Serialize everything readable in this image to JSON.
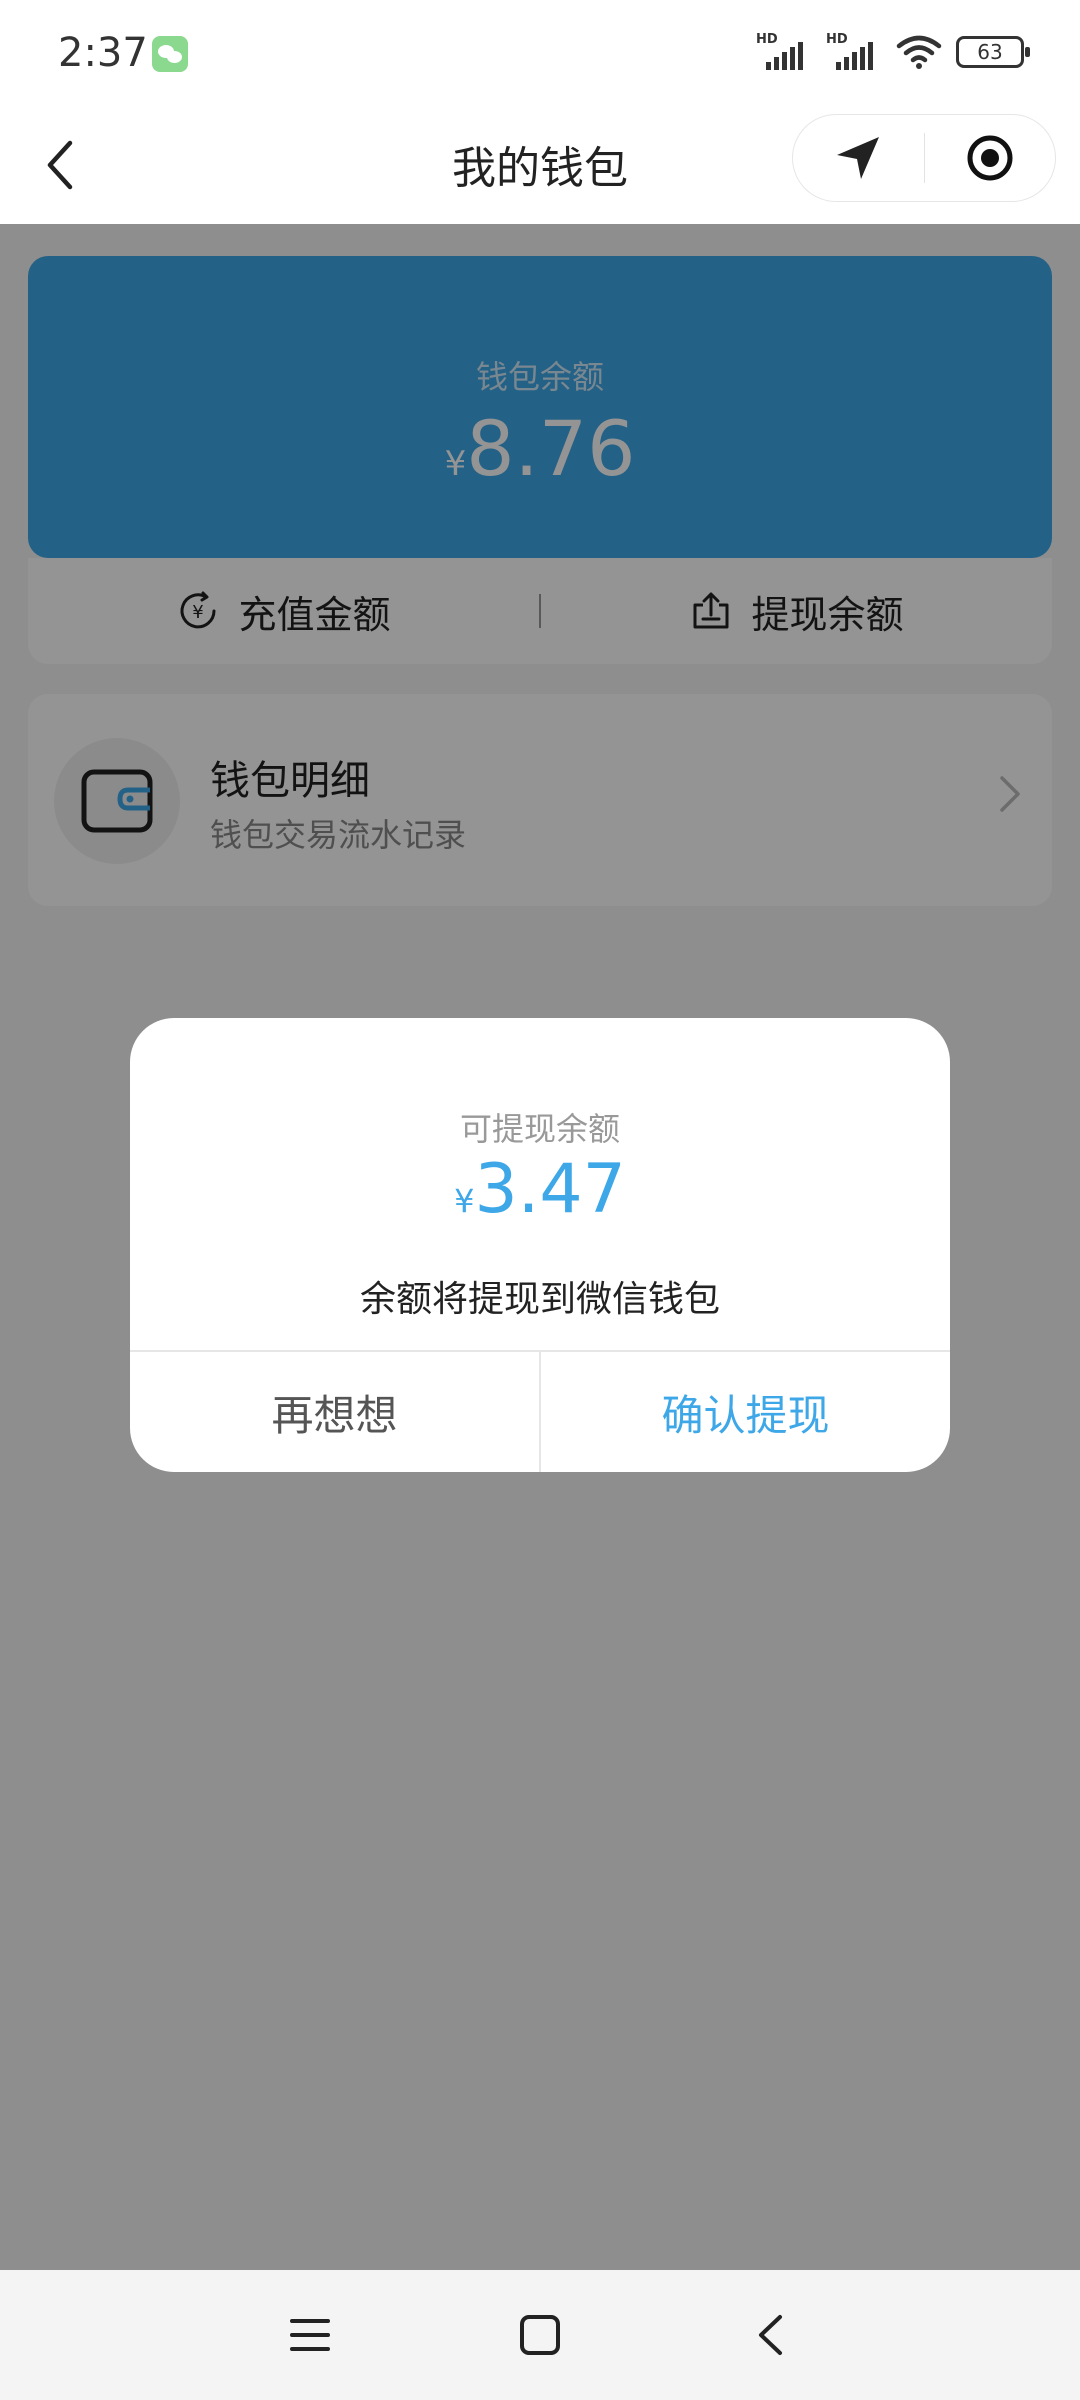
{
  "status_bar": {
    "time": "2:37",
    "signal_1_label": "HD",
    "signal_2_label": "HD",
    "battery": "63",
    "icons": [
      "wechat-notification-icon",
      "signal-icon",
      "wifi-icon",
      "battery-icon"
    ]
  },
  "header": {
    "title": "我的钱包",
    "icons": [
      "back-icon",
      "location-arrow-icon",
      "record-target-icon"
    ]
  },
  "wallet": {
    "label": "钱包余额",
    "currency": "¥",
    "amount": "8.76"
  },
  "actions": {
    "recharge": "充值金额",
    "withdraw": "提现余额"
  },
  "detail": {
    "title": "钱包明细",
    "subtitle": "钱包交易流水记录"
  },
  "dialog": {
    "label": "可提现余额",
    "currency": "¥",
    "amount": "3.47",
    "note": "余额将提现到微信钱包",
    "cancel": "再想想",
    "confirm": "确认提现"
  },
  "colors": {
    "accent": "#3ea7e8",
    "mask": "rgba(0,0,0,0.42)"
  }
}
